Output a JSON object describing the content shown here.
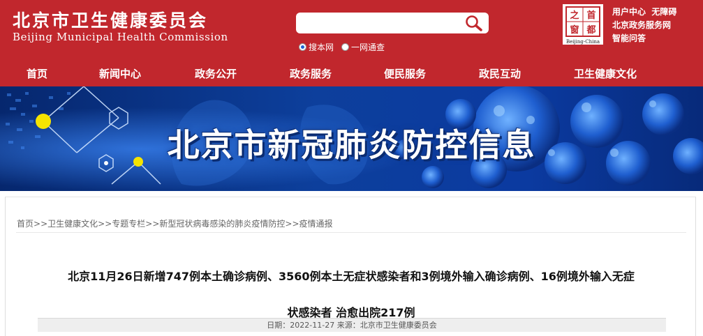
{
  "header": {
    "title_cn": "北京市卫生健康委员会",
    "title_en": "Beijing Municipal Health Commission",
    "search": {
      "value": "",
      "placeholder": ""
    },
    "scope_options": [
      {
        "label": "搜本网",
        "checked": true
      },
      {
        "label": "一网通查",
        "checked": false
      }
    ],
    "seal": {
      "chars": [
        "首",
        "都",
        "之",
        "窗"
      ],
      "caption": "Beijing-China"
    },
    "quick_links": [
      "用户中心",
      "无障碍",
      "北京政务服务网",
      "智能问答"
    ],
    "colors": {
      "brand_red": "#c1272d"
    }
  },
  "nav": [
    "首页",
    "新闻中心",
    "政务公开",
    "政务服务",
    "便民服务",
    "政民互动",
    "卫生健康文化"
  ],
  "banner": {
    "title": "北京市新冠肺炎防控信息"
  },
  "breadcrumb": {
    "items": [
      "首页",
      "卫生健康文化",
      "专题专栏",
      "新型冠状病毒感染的肺炎疫情防控",
      "疫情通报"
    ],
    "separator": ">>"
  },
  "article": {
    "title_line1": "北京11月26日新增747例本土确诊病例、3560例本土无症状感染者和3例境外输入确诊病例、16例境外输入无症",
    "title_line2": "状感染者 治愈出院217例",
    "meta": "日期：2022-11-27 来源：北京市卫生健康委员会"
  }
}
